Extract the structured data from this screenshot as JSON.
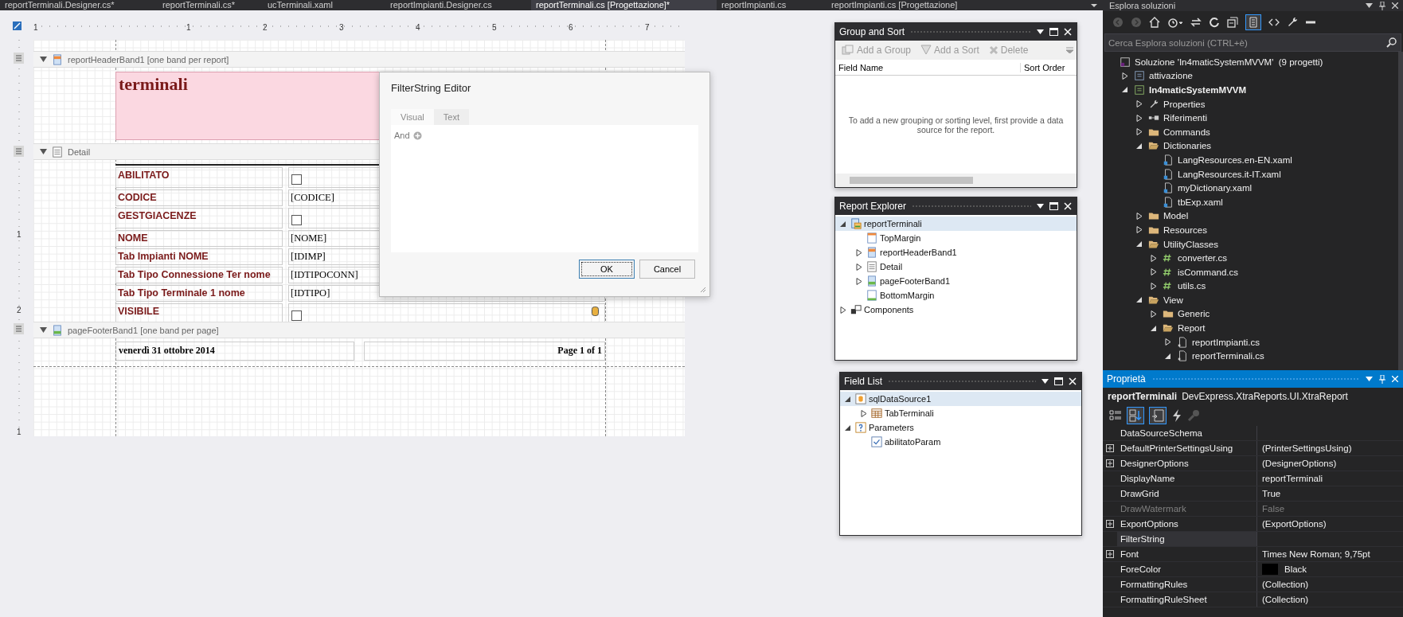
{
  "tabs": [
    {
      "label": "reportTerminali.Designer.cs*",
      "selected": false
    },
    {
      "label": "reportTerminali.cs*",
      "selected": false
    },
    {
      "label": "ucTerminali.xaml",
      "selected": false
    },
    {
      "label": "reportImpianti.Designer.cs",
      "selected": false
    },
    {
      "label": "reportTerminali.cs [Progettazione]*",
      "selected": true
    },
    {
      "label": "reportImpianti.cs",
      "selected": false
    },
    {
      "label": "reportImpianti.cs [Progettazione]",
      "selected": false
    }
  ],
  "ruler": {
    "top_marks": [
      "1",
      "1",
      "2",
      "3",
      "4",
      "5",
      "6",
      "7"
    ],
    "side_marks": [
      "1",
      "2",
      "1"
    ]
  },
  "report": {
    "header": {
      "band_label": "reportHeaderBand1 [one band per report]",
      "title": "terminali"
    },
    "detail": {
      "band_label": "Detail",
      "rows": [
        {
          "label": "ABILITATO",
          "kind": "checkbox",
          "checked": false
        },
        {
          "label": "CODICE",
          "kind": "field",
          "value": "[CODICE]"
        },
        {
          "label": "GESTGIACENZE",
          "kind": "checkbox",
          "checked": false
        },
        {
          "label": "NOME",
          "kind": "field",
          "value": "[NOME]"
        },
        {
          "label": "Tab Impianti NOME",
          "kind": "field",
          "value": "[IDIMP]"
        },
        {
          "label": "Tab Tipo Connessione Ter nome",
          "kind": "field",
          "value": "[IDTIPOCONN]"
        },
        {
          "label": "Tab Tipo Terminale 1 nome",
          "kind": "field",
          "value": "[IDTIPO]"
        },
        {
          "label": "VISIBILE",
          "kind": "checkbox",
          "checked": false
        }
      ]
    },
    "footer": {
      "band_label": "pageFooterBand1 [one band per page]",
      "date": "venerdì 31 ottobre 2014",
      "page": "Page 1 of 1"
    }
  },
  "filter_dialog": {
    "title": "FilterString Editor",
    "tabs": [
      {
        "label": "Visual",
        "selected": true
      },
      {
        "label": "Text",
        "selected": false
      }
    ],
    "group_operator": "And",
    "buttons": [
      {
        "label": "OK",
        "default": true
      },
      {
        "label": "Cancel",
        "default": false
      }
    ]
  },
  "group_and_sort": {
    "title": "Group and Sort",
    "toolbar": [
      {
        "label": "Add a Group",
        "kind": "group",
        "disabled": true
      },
      {
        "label": "Add a Sort",
        "kind": "sort",
        "disabled": true
      },
      {
        "label": "Delete",
        "kind": "delete",
        "disabled": true
      }
    ],
    "columns": [
      "Field Name",
      "Sort Order"
    ],
    "message": "To add a new grouping or sorting level, first provide a data source for the report."
  },
  "report_explorer": {
    "title": "Report Explorer",
    "tree": [
      {
        "label": "reportTerminali",
        "kind": "report",
        "expanded": true,
        "selected": true,
        "children": [
          {
            "label": "TopMargin",
            "kind": "margin",
            "selected": false
          },
          {
            "label": "reportHeaderBand1",
            "kind": "band-header",
            "expanded": false,
            "selected": false
          },
          {
            "label": "Detail",
            "kind": "detail",
            "expanded": false,
            "selected": false
          },
          {
            "label": "pageFooterBand1",
            "kind": "band-footer",
            "expanded": false,
            "selected": false
          },
          {
            "label": "BottomMargin",
            "kind": "margin-bottom",
            "selected": false
          }
        ]
      },
      {
        "label": "Components",
        "kind": "components",
        "expanded": false,
        "selected": false
      }
    ]
  },
  "field_list": {
    "title": "Field List",
    "tree": [
      {
        "label": "sqlDataSource1",
        "kind": "datasource",
        "expanded": true,
        "selected": true,
        "children": [
          {
            "label": "TabTerminali",
            "kind": "table",
            "expanded": false,
            "selected": false
          }
        ]
      },
      {
        "label": "Parameters",
        "kind": "parameters",
        "expanded": true,
        "selected": false,
        "children": [
          {
            "label": "abilitatoParam",
            "kind": "parameter-bool",
            "selected": false
          }
        ]
      }
    ]
  },
  "solution_explorer": {
    "title": "Esplora soluzioni",
    "search": {
      "placeholder": "Cerca Esplora soluzioni (CTRL+è)"
    },
    "tree": [
      {
        "label": "Soluzione 'In4maticSystemMVVM'  (9 progetti)",
        "kind": "solution",
        "children": [
          {
            "label": "attivazione",
            "kind": "vb-project",
            "expanded": false
          },
          {
            "label": "In4maticSystemMVVM",
            "kind": "cs-project",
            "bold": true,
            "expanded": true,
            "children": [
              {
                "label": "Properties",
                "kind": "properties",
                "expanded": false
              },
              {
                "label": "Riferimenti",
                "kind": "references",
                "expanded": false
              },
              {
                "label": "Commands",
                "kind": "folder",
                "expanded": false
              },
              {
                "label": "Dictionaries",
                "kind": "folder",
                "expanded": true,
                "children": [
                  {
                    "label": "LangResources.en-EN.xaml",
                    "kind": "xaml"
                  },
                  {
                    "label": "LangResources.it-IT.xaml",
                    "kind": "xaml"
                  },
                  {
                    "label": "myDictionary.xaml",
                    "kind": "xaml"
                  },
                  {
                    "label": "tbExp.xaml",
                    "kind": "xaml"
                  }
                ]
              },
              {
                "label": "Model",
                "kind": "folder",
                "expanded": false
              },
              {
                "label": "Resources",
                "kind": "folder",
                "expanded": false
              },
              {
                "label": "UtilityClasses",
                "kind": "folder",
                "expanded": true,
                "children": [
                  {
                    "label": "converter.cs",
                    "kind": "cs",
                    "expanded": false
                  },
                  {
                    "label": "isCommand.cs",
                    "kind": "cs",
                    "expanded": false
                  },
                  {
                    "label": "utils.cs",
                    "kind": "cs",
                    "expanded": false
                  }
                ]
              },
              {
                "label": "View",
                "kind": "folder",
                "expanded": true,
                "children": [
                  {
                    "label": "Generic",
                    "kind": "folder",
                    "expanded": false
                  },
                  {
                    "label": "Report",
                    "kind": "folder",
                    "expanded": true,
                    "children": [
                      {
                        "label": "reportImpianti.cs",
                        "kind": "report-cs",
                        "expanded": false
                      },
                      {
                        "label": "reportTerminali.cs",
                        "kind": "report-cs",
                        "expanded": true
                      }
                    ]
                  }
                ]
              }
            ]
          }
        ]
      }
    ]
  },
  "properties": {
    "title": "Proprietà",
    "object_name": "reportTerminali",
    "object_type": "DevExpress.XtraReports.UI.XtraReport",
    "rows": [
      {
        "name": "DataSourceSchema",
        "selected": false,
        "disabled": false
      },
      {
        "name": "DefaultPrinterSettingsUsing",
        "value": "(PrinterSettingsUsing)",
        "expanded": false,
        "selected": false,
        "disabled": false
      },
      {
        "name": "DesignerOptions",
        "value": "(DesignerOptions)",
        "expanded": false,
        "selected": false,
        "disabled": false
      },
      {
        "name": "DisplayName",
        "value": "reportTerminali",
        "selected": false,
        "disabled": false
      },
      {
        "name": "DrawGrid",
        "value": "True",
        "selected": false,
        "disabled": false
      },
      {
        "name": "DrawWatermark",
        "value": "False",
        "selected": false,
        "disabled": true
      },
      {
        "name": "ExportOptions",
        "value": "(ExportOptions)",
        "expanded": false,
        "selected": false,
        "disabled": false
      },
      {
        "name": "FilterString",
        "selected": true,
        "disabled": false
      },
      {
        "name": "Font",
        "value": "Times New Roman; 9,75pt",
        "expanded": false,
        "selected": false,
        "disabled": false
      },
      {
        "name": "ForeColor",
        "value": "Black",
        "color": "#000000",
        "selected": false,
        "disabled": false
      },
      {
        "name": "FormattingRules",
        "value": "(Collection)",
        "selected": false,
        "disabled": false
      },
      {
        "name": "FormattingRuleSheet",
        "value": "(Collection)",
        "selected": false,
        "disabled": false
      }
    ]
  }
}
